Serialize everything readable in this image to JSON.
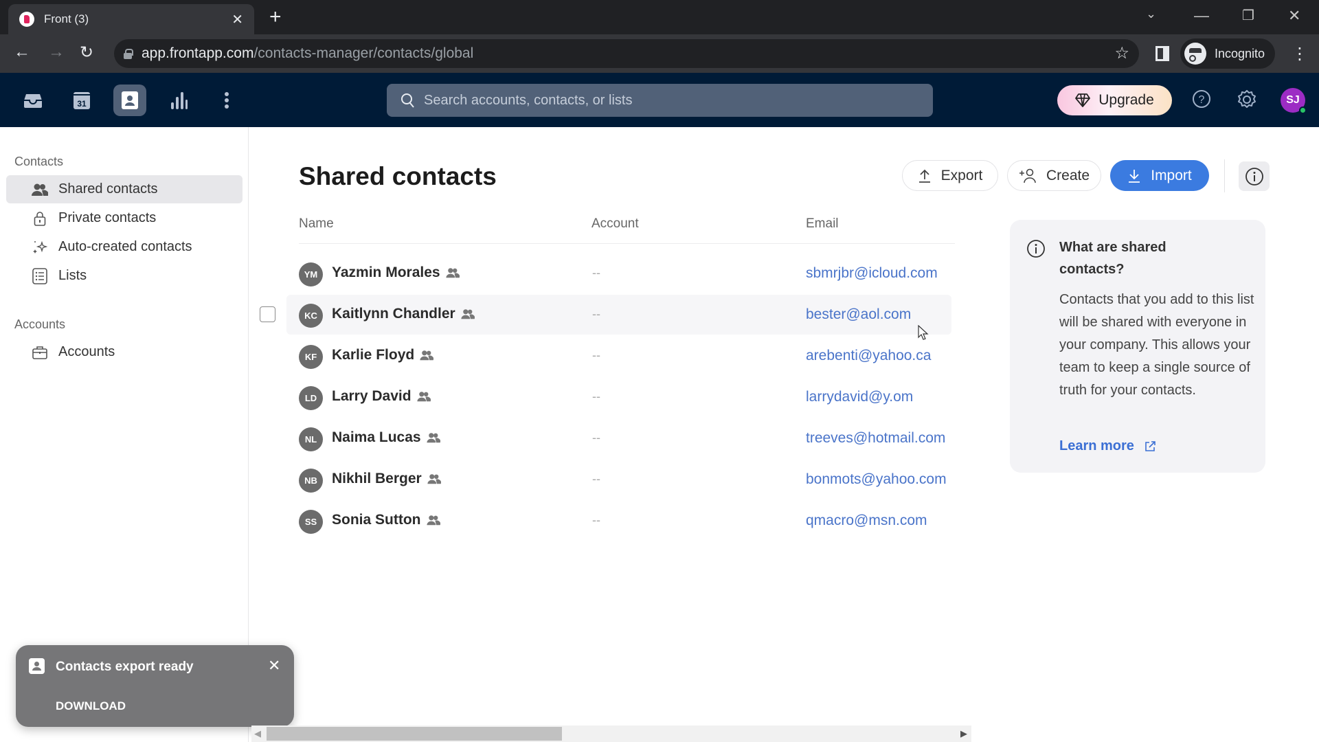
{
  "browser": {
    "tab_title": "Front (3)",
    "url_host": "app.frontapp.com",
    "url_path": "/contacts-manager/contacts/global",
    "profile_label": "Incognito"
  },
  "header": {
    "nav_icons": [
      "inbox-icon",
      "calendar-icon",
      "contacts-icon",
      "analytics-icon",
      "more-icon"
    ],
    "calendar_day": "31",
    "search_placeholder": "Search accounts, contacts, or lists",
    "upgrade_label": "Upgrade",
    "avatar_initials": "SJ",
    "colors": {
      "bar": "#001b37",
      "avatar": "#9c2cc4",
      "status_online": "#28c466"
    }
  },
  "sidebar": {
    "contacts_heading": "Contacts",
    "contacts_items": [
      {
        "label": "Shared contacts",
        "icon": "users-icon",
        "active": true
      },
      {
        "label": "Private contacts",
        "icon": "lock-icon",
        "active": false
      },
      {
        "label": "Auto-created contacts",
        "icon": "sparkles-icon",
        "active": false
      },
      {
        "label": "Lists",
        "icon": "list-icon",
        "active": false
      }
    ],
    "accounts_heading": "Accounts",
    "accounts_items": [
      {
        "label": "Accounts",
        "icon": "briefcase-icon",
        "active": false
      }
    ]
  },
  "main": {
    "title": "Shared contacts",
    "buttons": {
      "export": "Export",
      "create": "Create",
      "import": "Import"
    },
    "columns": {
      "name": "Name",
      "account": "Account",
      "email": "Email"
    },
    "rows": [
      {
        "initials": "YM",
        "name": "Yazmin Morales",
        "account": "--",
        "email": "sbmrjbr@icloud.com"
      },
      {
        "initials": "KC",
        "name": "Kaitlynn Chandler",
        "account": "--",
        "email": "bester@aol.com"
      },
      {
        "initials": "KF",
        "name": "Karlie Floyd",
        "account": "--",
        "email": "arebenti@yahoo.ca"
      },
      {
        "initials": "LD",
        "name": "Larry David",
        "account": "--",
        "email": "larrydavid@y.om"
      },
      {
        "initials": "NL",
        "name": "Naima Lucas",
        "account": "--",
        "email": "treeves@hotmail.com"
      },
      {
        "initials": "NB",
        "name": "Nikhil Berger",
        "account": "--",
        "email": "bonmots@yahoo.com"
      },
      {
        "initials": "SS",
        "name": "Sonia Sutton",
        "account": "--",
        "email": "qmacro@msn.com"
      }
    ],
    "accent_color": "#3b7be0"
  },
  "info_card": {
    "title": "What are shared contacts?",
    "body": "Contacts that you add to this list will be shared with everyone in your company. This allows your team to keep a single source of truth for your contacts.",
    "link": "Learn more"
  },
  "toast": {
    "title": "Contacts export ready",
    "action": "DOWNLOAD"
  }
}
